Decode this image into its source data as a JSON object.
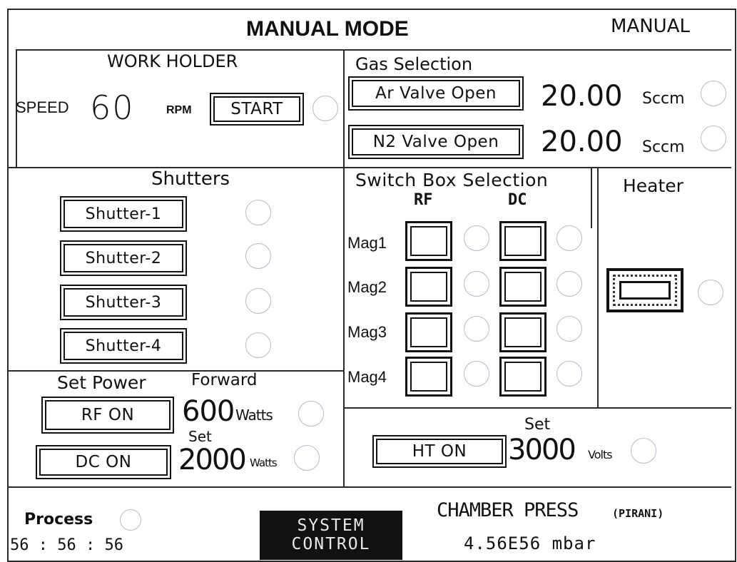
{
  "title": "MANUAL MODE",
  "mode": "MANUAL",
  "work_holder": {
    "title": "WORK HOLDER",
    "speed_label": "SPEED",
    "speed_value": "60",
    "speed_unit": "RPM",
    "start_label": "START"
  },
  "gas": {
    "title": "Gas Selection",
    "ar_label": "Ar Valve Open",
    "ar_value": "20.00",
    "n2_label": "N2 Valve Open",
    "n2_value": "20.00",
    "unit": "Sccm"
  },
  "shutters": {
    "title": "Shutters",
    "items": [
      "Shutter-1",
      "Shutter-2",
      "Shutter-3",
      "Shutter-4"
    ]
  },
  "switch_box": {
    "title": "Switch Box Selection",
    "rf_label": "RF",
    "dc_label": "DC",
    "mags": [
      "Mag1",
      "Mag2",
      "Mag3",
      "Mag4"
    ]
  },
  "heater": {
    "title": "Heater"
  },
  "power": {
    "title": "Set Power",
    "forward_label": "Forward",
    "set_label": "Set",
    "rf_label": "RF ON",
    "rf_value": "600",
    "rf_unit": "Watts",
    "dc_label": "DC ON",
    "dc_value": "2000",
    "dc_unit": "Watts"
  },
  "ht": {
    "set_label": "Set",
    "label": "HT ON",
    "value": "3000",
    "unit": "Volts"
  },
  "process": {
    "label": "Process",
    "time": "56 : 56 : 56"
  },
  "system_control": {
    "line1": "SYSTEM",
    "line2": "CONTROL"
  },
  "chamber": {
    "label": "CHAMBER PRESS",
    "sub": "(PIRANI)",
    "value": "4.56E56 mbar"
  },
  "colors": {
    "frame": "#2a2a2a",
    "indicator": "#b9b9c9",
    "system_bg": "#111111"
  }
}
